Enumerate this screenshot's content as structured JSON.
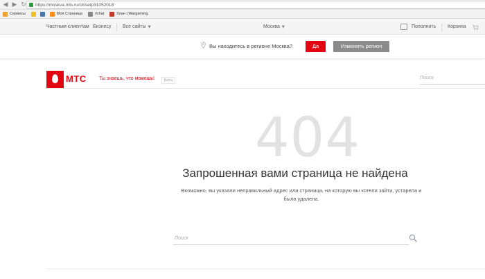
{
  "browser": {
    "url": "https://moskva.mts.ru/closetp31052018",
    "bookmarks": [
      {
        "label": "Сервисы",
        "color": "#f0a030"
      },
      {
        "label": "",
        "color": "#f0c020"
      },
      {
        "label": "",
        "color": "#4a76a8"
      },
      {
        "label": "Моя Страница",
        "color": "#ff8c1a"
      },
      {
        "label": "#chat",
        "color": "#888888"
      },
      {
        "label": "Клан | Wargaming.",
        "color": "#c0392b"
      }
    ]
  },
  "topnav": {
    "private": "Частным клиентам",
    "business": "Бизнесу",
    "all_sites": "Все сайты",
    "city": "Москва",
    "topup": "Пополнить",
    "cart": "Корзина"
  },
  "region": {
    "question": "Вы находитесь в регионе Москва?",
    "yes": "Да",
    "change": "Изменить регион"
  },
  "header": {
    "logo": "МТС",
    "slogan": "Ты знаешь, что можешь!",
    "beta": "Бета",
    "search_placeholder": "Поиск"
  },
  "error": {
    "code": "404",
    "title": "Запрошенная вами страница не найдена",
    "description": "Возможно, вы указали неправильный адрес или страница, на которую вы хотели зайти, устарела и была удалена.",
    "search_placeholder": "Поиск"
  },
  "colors": {
    "brand_red": "#e30611",
    "button_gray": "#8a8a8a"
  }
}
